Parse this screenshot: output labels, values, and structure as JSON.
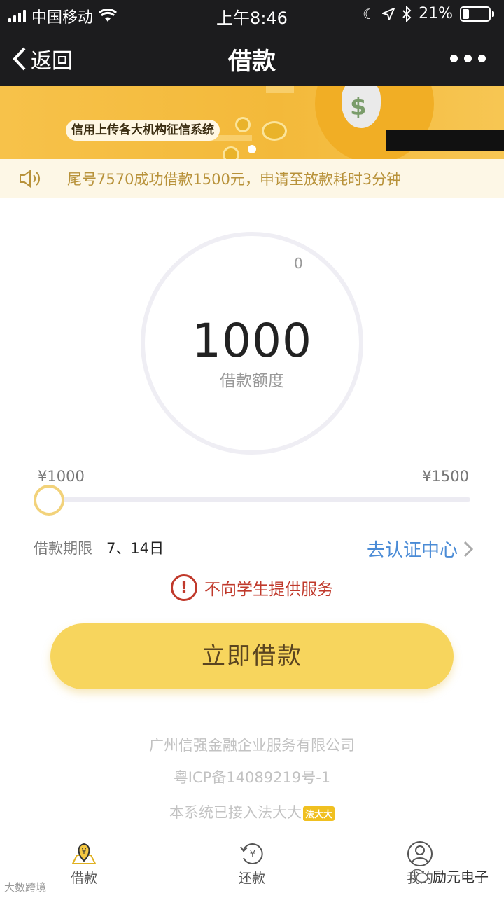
{
  "status_bar": {
    "carrier": "中国移动",
    "time": "上午8:46",
    "battery": "21%",
    "icons": [
      "signal-icon",
      "wifi-icon",
      "moon-icon",
      "location-icon",
      "bluetooth-icon",
      "battery-icon"
    ]
  },
  "nav": {
    "back_label": "返回",
    "title": "借款"
  },
  "banner": {
    "text": "信用上传各大机构征信系统"
  },
  "notice": {
    "text": "尾号7570成功借款1500元，申请至放款耗时3分钟"
  },
  "loan": {
    "gauge_zero": "0",
    "amount": "1000",
    "amount_label": "借款额度",
    "slider_min": "¥1000",
    "slider_max": "¥1500",
    "slider_fraction": 0,
    "term_label": "借款期限",
    "term_value": "7、14日",
    "verify_link": "去认证中心",
    "warning": "不向学生提供服务",
    "cta": "立即借款"
  },
  "footer": {
    "company": "广州信强金融企业服务有限公司",
    "icp": "粤ICP备14089219号-1",
    "system_prefix": "本系统已接入法大大",
    "logo_text": "法大大"
  },
  "tabs": [
    {
      "label": "借款",
      "icon": "loan-icon"
    },
    {
      "label": "还款",
      "icon": "repay-icon"
    },
    {
      "label": "我的",
      "icon": "profile-icon"
    }
  ],
  "watermarks": {
    "left": "大数跨境",
    "right": "励元电子"
  },
  "colors": {
    "accent": "#f7d55d",
    "link": "#4a8bd6",
    "warning": "#c0392b",
    "nav_bg": "#1c1c1e"
  }
}
